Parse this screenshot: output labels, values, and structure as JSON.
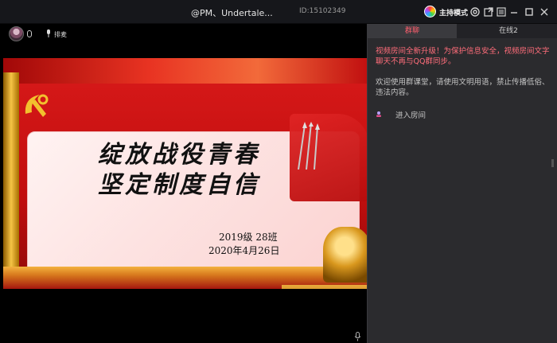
{
  "titlebar": {
    "room_title": "@PM、Undertale...",
    "room_id": "ID:15102349",
    "host_mode_label": "主持模式",
    "icons": [
      "host-logo-icon",
      "settings-icon",
      "popout-icon",
      "menu-icon",
      "minimize-icon",
      "maximize-icon",
      "close-icon"
    ]
  },
  "video": {
    "mic_queue_label": "排麦",
    "slide": {
      "title_line1": "绽放战役青春",
      "title_line2": "坚定制度自信",
      "class_label": "2019级 28班",
      "date_label": "2020年4月26日"
    }
  },
  "panel": {
    "tabs": [
      {
        "label": "群聊",
        "active": true
      },
      {
        "label": "在线2",
        "active": false
      }
    ],
    "notice": "视频房间全新升级！为保护信息安全，视频房间文字聊天不再与QQ群同步。",
    "welcome": "欢迎使用群课堂，请使用文明用语，禁止传播低俗、违法内容。",
    "system_message": "进入房间"
  },
  "colors": {
    "accent": "#ff5f6d",
    "panel_bg": "#2b2b2e",
    "titlebar_bg": "#16171b"
  }
}
